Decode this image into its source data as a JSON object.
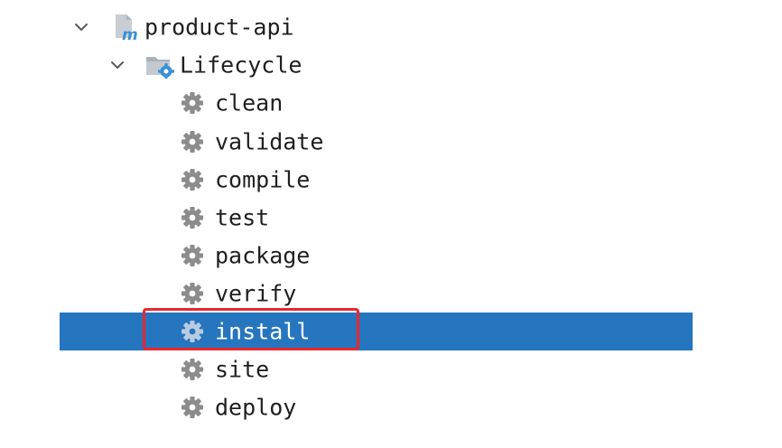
{
  "tree": {
    "project": {
      "label": "product-api",
      "icon": "maven-module-icon",
      "expanded": true
    },
    "lifecycle": {
      "label": "Lifecycle",
      "icon": "lifecycle-folder-icon",
      "expanded": true
    },
    "goals": [
      {
        "label": "clean",
        "icon": "gear-icon"
      },
      {
        "label": "validate",
        "icon": "gear-icon"
      },
      {
        "label": "compile",
        "icon": "gear-icon"
      },
      {
        "label": "test",
        "icon": "gear-icon"
      },
      {
        "label": "package",
        "icon": "gear-icon"
      },
      {
        "label": "verify",
        "icon": "gear-icon"
      },
      {
        "label": "install",
        "icon": "gear-icon",
        "selected": true
      },
      {
        "label": "site",
        "icon": "gear-icon"
      },
      {
        "label": "deploy",
        "icon": "gear-icon"
      }
    ]
  },
  "colors": {
    "selection": "#2675bf",
    "highlight_border": "#e8282d",
    "gear": "#8c8c8c",
    "text": "#1f1f1f",
    "maven_blue": "#3a8fd6"
  }
}
